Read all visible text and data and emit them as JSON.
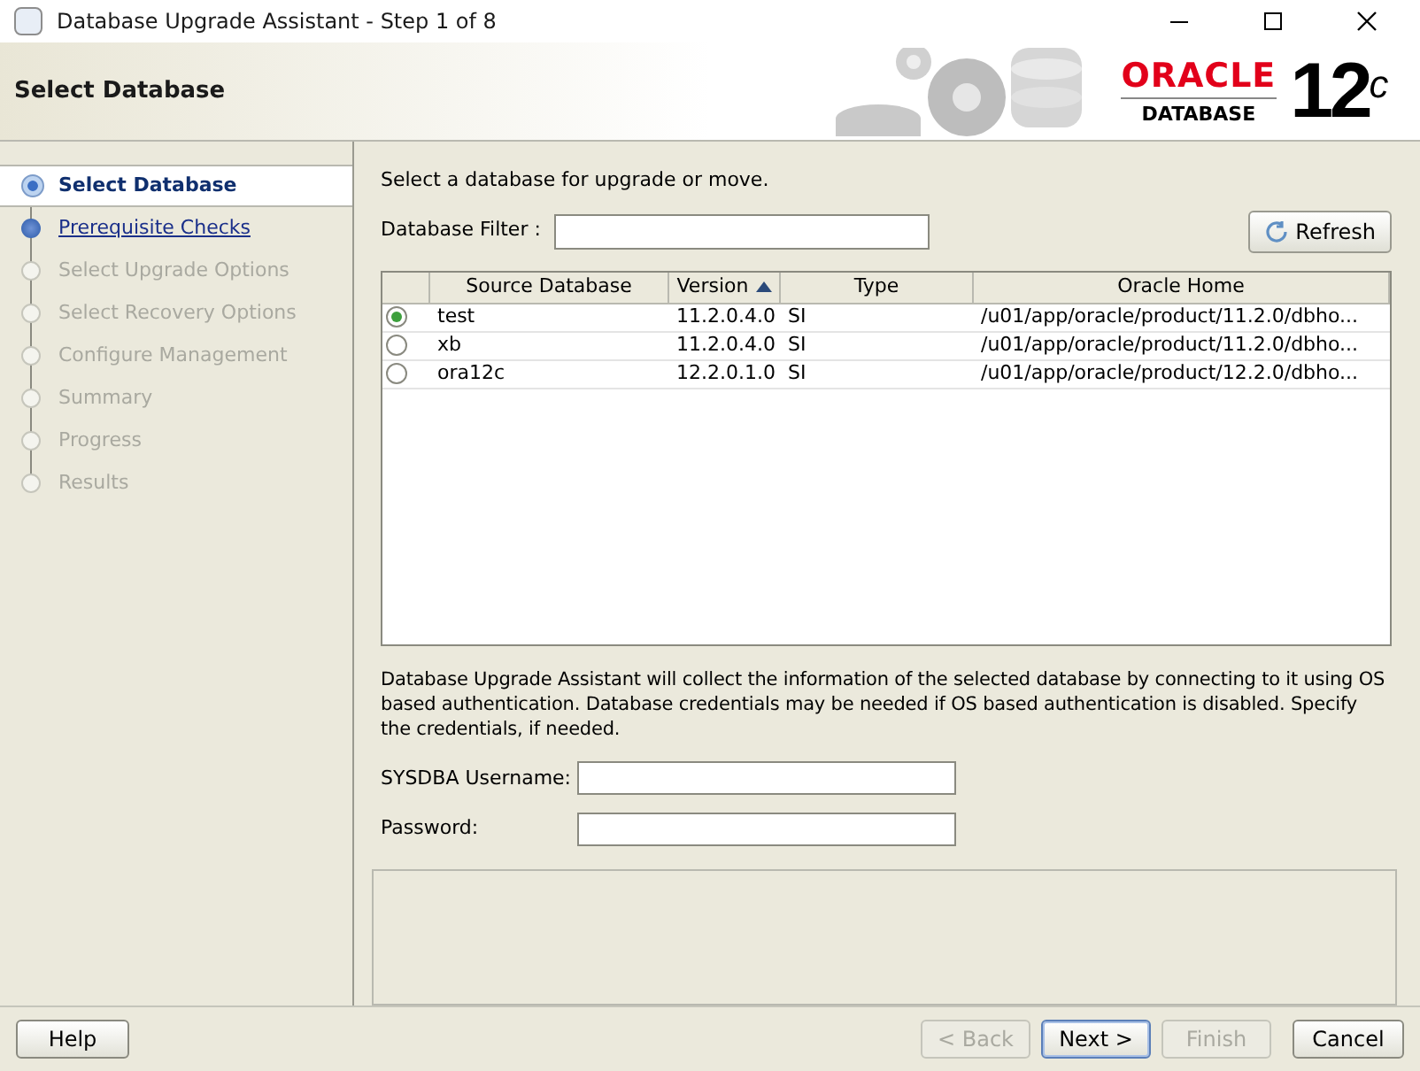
{
  "window": {
    "title": "Database Upgrade Assistant - Step 1 of 8"
  },
  "header": {
    "title": "Select Database",
    "logo": {
      "brand": "ORACLE",
      "product": "DATABASE",
      "version": "12",
      "version_suffix": "c"
    }
  },
  "steps": [
    {
      "label": "Select Database",
      "selected": true,
      "enabled": true
    },
    {
      "label": "Prerequisite Checks",
      "selected": false,
      "enabled": true
    },
    {
      "label": "Select Upgrade Options",
      "selected": false,
      "enabled": false
    },
    {
      "label": "Select Recovery Options",
      "selected": false,
      "enabled": false
    },
    {
      "label": "Configure Management",
      "selected": false,
      "enabled": false
    },
    {
      "label": "Summary",
      "selected": false,
      "enabled": false
    },
    {
      "label": "Progress",
      "selected": false,
      "enabled": false
    },
    {
      "label": "Results",
      "selected": false,
      "enabled": false
    }
  ],
  "intro": "Select a database for upgrade or move.",
  "filter": {
    "label": "Database Filter :"
  },
  "refresh_button": "Refresh",
  "table": {
    "columns": [
      "Source Database",
      "Version",
      "Type",
      "Oracle Home"
    ],
    "rows": [
      {
        "selected": true,
        "cells": [
          "test",
          "11.2.0.4.0",
          "SI",
          "/u01/app/oracle/product/11.2.0/dbho..."
        ]
      },
      {
        "selected": false,
        "cells": [
          "xb",
          "11.2.0.4.0",
          "SI",
          "/u01/app/oracle/product/11.2.0/dbho..."
        ]
      },
      {
        "selected": false,
        "cells": [
          "ora12c",
          "12.2.0.1.0",
          "SI",
          "/u01/app/oracle/product/12.2.0/dbho..."
        ]
      }
    ]
  },
  "info": "Database Upgrade Assistant will collect the information of the selected database by connecting to it using OS based authentication. Database credentials may be needed if OS based authentication is disabled. Specify the credentials, if needed.",
  "credentials": [
    {
      "label": "SYSDBA Username:"
    },
    {
      "label": "Password:"
    }
  ],
  "buttons": {
    "help": {
      "label": "Help",
      "enabled": true
    },
    "nav": [
      {
        "label": "< Back",
        "enabled": false,
        "default": false
      },
      {
        "label": "Next >",
        "enabled": true,
        "default": true
      },
      {
        "label": "Finish",
        "enabled": false,
        "default": false
      },
      {
        "label": "Cancel",
        "enabled": true,
        "default": false
      }
    ]
  }
}
